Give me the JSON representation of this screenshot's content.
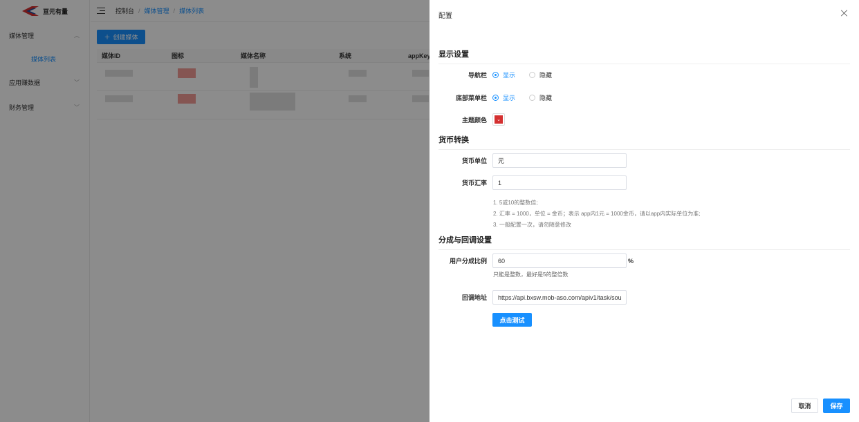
{
  "brand": {
    "name": "亘元有量"
  },
  "sidebar": {
    "items": [
      {
        "label": "媒体管理",
        "expanded": true,
        "children": [
          {
            "label": "媒体列表",
            "active": true
          }
        ]
      },
      {
        "label": "应用赚数据",
        "expanded": false
      },
      {
        "label": "财务管理",
        "expanded": false
      }
    ]
  },
  "breadcrumb": {
    "items": [
      "控制台",
      "媒体管理",
      "媒体列表"
    ],
    "separator": "/"
  },
  "toolbar": {
    "create_label": "创建媒体"
  },
  "table": {
    "columns": [
      "媒体ID",
      "图标",
      "媒体名称",
      "系统",
      "appKey"
    ]
  },
  "drawer": {
    "title": "配置",
    "display_section": {
      "title": "显示设置",
      "navbar": {
        "label": "导航栏",
        "options": [
          "显示",
          "隐藏"
        ],
        "selected": "显示"
      },
      "bottom_menu": {
        "label": "底部菜单栏",
        "options": [
          "显示",
          "隐藏"
        ],
        "selected": "显示"
      },
      "theme_color": {
        "label": "主题颜色",
        "value": "#d43030"
      }
    },
    "currency_section": {
      "title": "货币转换",
      "unit": {
        "label": "货币单位",
        "value": "元"
      },
      "rate": {
        "label": "货币汇率",
        "value": "1"
      },
      "notes": [
        "1. 5或10的整数倍;",
        "2. 汇率 = 1000，单位 = 金币；表示 app内1元 = 1000金币，请以app内实际单位为准;",
        "3. 一般配置一次，请勿随意修改"
      ]
    },
    "share_section": {
      "title": "分成与回调设置",
      "ratio": {
        "label": "用户分成比例",
        "value": "60",
        "suffix": "%",
        "hint": "只能是整数，最好是5的整倍数"
      },
      "callback": {
        "label": "回调地址",
        "value": "https://api.bxsw.mob-aso.com/apiv1/task/sou"
      },
      "test_label": "点击测试"
    },
    "footer": {
      "cancel_label": "取消",
      "save_label": "保存"
    }
  },
  "colors": {
    "primary": "#1890ff",
    "overlay": "rgba(0,0,0,0.45)",
    "brand_red": "#d43030"
  }
}
